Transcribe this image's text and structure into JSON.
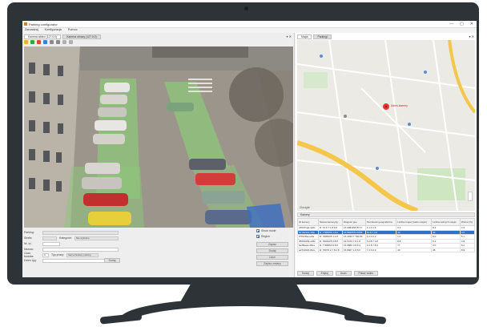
{
  "app": {
    "title": "Parking configurator",
    "window_controls": [
      "—",
      "▢",
      "✕"
    ]
  },
  "menu": [
    "Zarzadzaj",
    "Konfiguracja",
    "Pomoc"
  ],
  "left_tabs": [
    {
      "label": "Kamera wideo (127.0.0)",
      "active": true
    },
    {
      "label": "Kamera obrazy (127.0.0)",
      "active": false
    }
  ],
  "left_pane_ctrl": "▾ ✕",
  "right_tabs": [
    {
      "label": "Mapa",
      "active": true
    },
    {
      "label": "Parkingi",
      "active": false
    }
  ],
  "right_pane_ctrl": "▾ ✕",
  "map": {
    "marker_label": "Adres kamery",
    "google_label": "Google"
  },
  "form": {
    "parking_label": "Parking:",
    "strona_label": "Strefa:",
    "kategorie_label": "Kategorie:",
    "kategorie_value": "Nie wybrano",
    "nr_label": "Nr. ul.:",
    "nazwa_label": "Nazwa:",
    "czas_label": "Czas trwania:",
    "czas_value": "0",
    "typ_label": "Typ pracy:",
    "typ_value": "Samochodowy parking",
    "dzien_label": "Dzien tyg:",
    "dodaj_label": "Dodaj",
    "show_label": "Show mode",
    "region_label": "Region",
    "btn_labels": [
      "Zapisz",
      "Dodaj",
      "Usuń",
      "Zapisz zmiany"
    ]
  },
  "camera_panel": {
    "title": "Kamery",
    "columns": [
      "ID kamery",
      "Nazwa kamery/ip",
      "Długość geo",
      "Szerokość geograficzna",
      "Liczba miejsc (radio miejsc)",
      "Liczba wolnych miejsc",
      "Wolne (%)"
    ],
    "rows": [
      {
        "id": "c56371ad-4e0c",
        "ip": "R: 76.8 7.1.8.6.8",
        "lon": "15.9384035.87 8",
        "lat": "4.1.0.1.5",
        "spots": "0.1",
        "free": "8.3",
        "pct": "3.4",
        "selected": false
      },
      {
        "id": "8179e6e5-4f9e",
        "ip": "R: 7786656 1.8.6",
        "lon": "15.9848703.8786",
        "lat": "10.8.7.4.8",
        "spots": "34",
        "free": "34",
        "pct": "3.5",
        "selected": true
      },
      {
        "id": "2f79c3ba-e2fa",
        "ip": "R: 7895636 1.2.8",
        "lon": "15.4039 7 700,83",
        "lat": "1.2.0.0.2",
        "spots": "1.0",
        "free": "8.0",
        "pct": "5.1",
        "selected": false
      },
      {
        "id": "d5661069-e93c",
        "ip": "R: 7801625 0.8.8",
        "lon": "15.6479 7 8.1 8",
        "lat": "5.0.8.7 0.8",
        "spots": "8.8",
        "free": "5.2",
        "pct": "4.9",
        "selected": false
      },
      {
        "id": "fac89ae9-d81a",
        "ip": "R: 7796860 8.8.8",
        "lon": "15.9886 3.8.8.3",
        "lat": "1.0.8.7.8.9",
        "spots": "77",
        "free": "0.0",
        "pct": "5.2",
        "selected": false
      },
      {
        "id": "ad719020-8bcc",
        "ip": "R: 78076 2.7 8.2.8",
        "lon": "15.8907 1.8 8.6",
        "lat": "7.4 6.0.9",
        "spots": "43",
        "free": "38",
        "pct": "8.9",
        "selected": false
      }
    ]
  },
  "bottom_buttons": [
    "Dodaj",
    "Edytuj",
    "Usuń",
    "Pokaż wideo"
  ],
  "colors": {
    "bezel": "#2e3338",
    "selection": "#2f73c9",
    "parking_zone": "#8ec77a",
    "map_road": "#f4c64a",
    "map_marker": "#e53935"
  }
}
